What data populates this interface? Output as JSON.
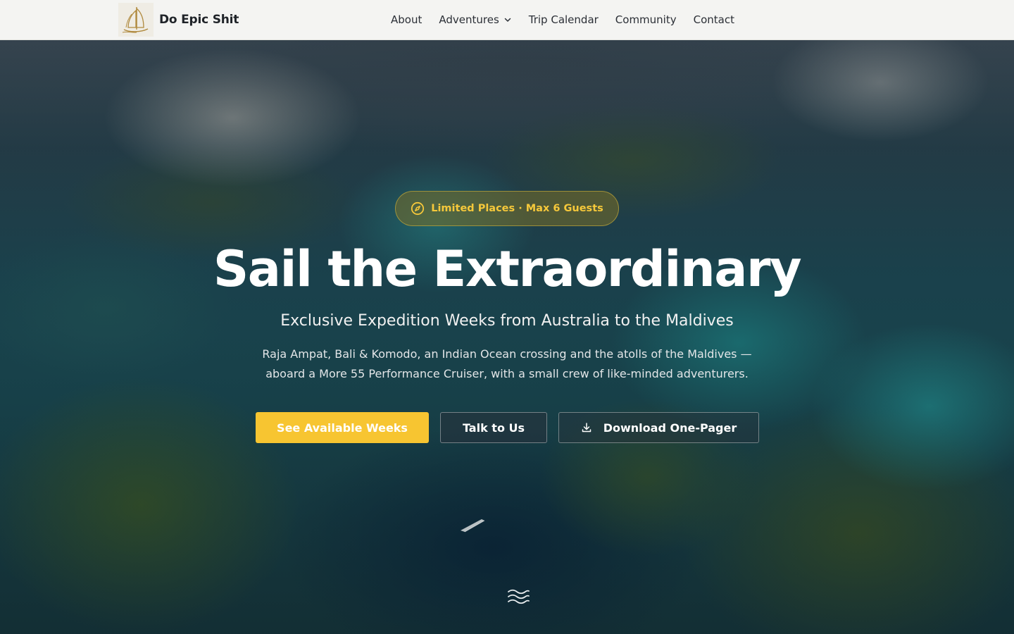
{
  "brand": {
    "name": "Do Epic Shit",
    "logo_icon": "sailboat-logo"
  },
  "nav": {
    "items": [
      {
        "label": "About"
      },
      {
        "label": "Adventures",
        "has_dropdown": true
      },
      {
        "label": "Trip Calendar"
      },
      {
        "label": "Community"
      },
      {
        "label": "Contact"
      }
    ]
  },
  "hero": {
    "badge": {
      "text": "Limited Places · Max 6 Guests",
      "icon": "compass-icon"
    },
    "title": "Sail the Extraordinary",
    "subtitle": "Exclusive Expedition Weeks from Australia to the Maldives",
    "description_line1": "Raja Ampat, Bali & Komodo, an Indian Ocean crossing and the atolls of the Maldives —",
    "description_line2": "aboard a More 55 Performance Cruiser, with a small crew of like-minded adventurers.",
    "buttons": {
      "primary": "See Available Weeks",
      "secondary": "Talk to Us",
      "download": "Download One-Pager"
    },
    "scroll_icon": "waves-icon"
  },
  "colors": {
    "accent": "#f7c531",
    "nav_bg": "#f4f4f2",
    "badge_text": "#f6c83a"
  }
}
